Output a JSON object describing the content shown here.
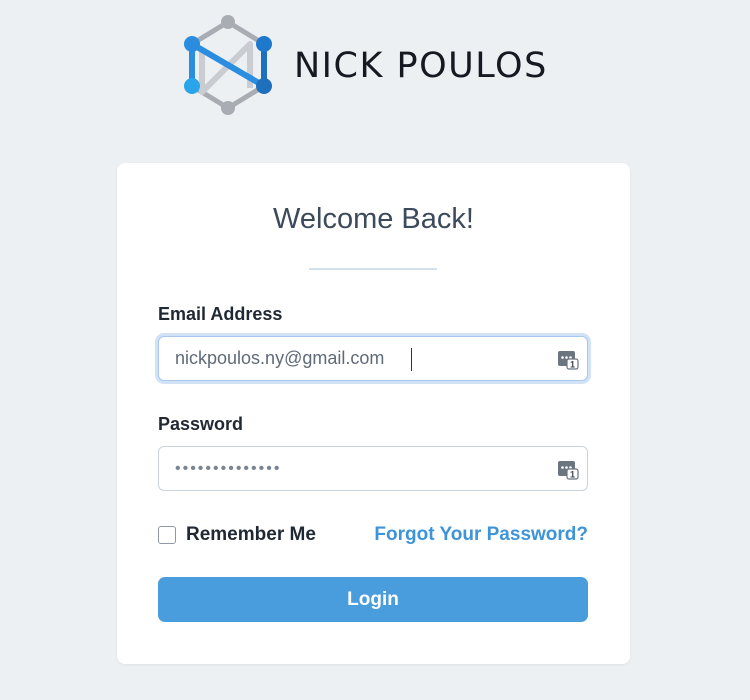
{
  "brand": {
    "name": "NICK POULOS",
    "colors": {
      "blue": "#2a8de0",
      "dark_blue": "#1e6fbd",
      "gray": "#a8adb3"
    }
  },
  "login_card": {
    "title": "Welcome Back!",
    "email_label": "Email Address",
    "email_value": "nickpoulos.ny@gmail.com",
    "password_label": "Password",
    "password_value": "••••••••••••••",
    "remember_label": "Remember Me",
    "remember_checked": false,
    "forgot_link": "Forgot Your Password?",
    "login_button": "Login",
    "accent_color": "#4a9ddd",
    "link_color": "#3d94d8"
  },
  "icons": {
    "logo": "hexagon-n-logo-icon",
    "password_manager": "password-manager-icon"
  }
}
